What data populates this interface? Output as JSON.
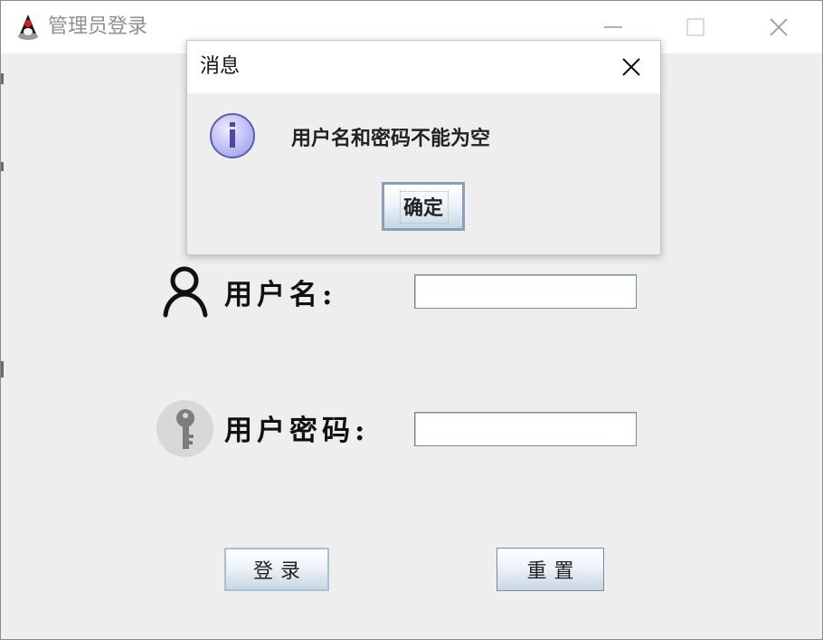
{
  "window": {
    "title": "管理员登录",
    "icon": "java-duke-icon",
    "controls": [
      "minimize-icon",
      "maximize-icon",
      "close-icon"
    ]
  },
  "form": {
    "username_label": "用户名:",
    "password_label": "用户密码:",
    "username_value": "",
    "password_value": "",
    "username_icon": "user-icon",
    "password_icon": "key-icon",
    "login_button": "登录",
    "reset_button": "重置"
  },
  "dialog": {
    "title": "消息",
    "message": "用户名和密码不能为空",
    "ok_button": "确定",
    "icon": "info-icon",
    "close_icon": "close-icon"
  },
  "colors": {
    "window_bg": "#eeeeee",
    "titlebar_bg": "#ffffff",
    "title_text": "#8f8f8f",
    "button_gradient_bottom": "#c7d6e4",
    "info_icon_fill": "#c9c9f5"
  }
}
